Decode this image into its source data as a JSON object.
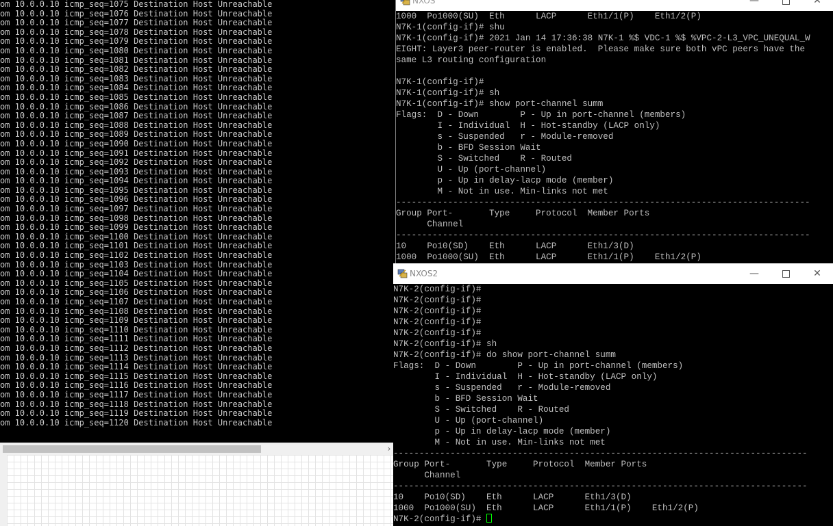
{
  "left_console": {
    "lines": [
      "om 10.0.0.10 icmp_seq=1075 Destination Host Unreachable",
      "om 10.0.0.10 icmp_seq=1076 Destination Host Unreachable",
      "om 10.0.0.10 icmp_seq=1077 Destination Host Unreachable",
      "om 10.0.0.10 icmp_seq=1078 Destination Host Unreachable",
      "om 10.0.0.10 icmp_seq=1079 Destination Host Unreachable",
      "om 10.0.0.10 icmp_seq=1080 Destination Host Unreachable",
      "om 10.0.0.10 icmp_seq=1081 Destination Host Unreachable",
      "om 10.0.0.10 icmp_seq=1082 Destination Host Unreachable",
      "om 10.0.0.10 icmp_seq=1083 Destination Host Unreachable",
      "om 10.0.0.10 icmp_seq=1084 Destination Host Unreachable",
      "om 10.0.0.10 icmp_seq=1085 Destination Host Unreachable",
      "om 10.0.0.10 icmp_seq=1086 Destination Host Unreachable",
      "om 10.0.0.10 icmp_seq=1087 Destination Host Unreachable",
      "om 10.0.0.10 icmp_seq=1088 Destination Host Unreachable",
      "om 10.0.0.10 icmp_seq=1089 Destination Host Unreachable",
      "om 10.0.0.10 icmp_seq=1090 Destination Host Unreachable",
      "om 10.0.0.10 icmp_seq=1091 Destination Host Unreachable",
      "om 10.0.0.10 icmp_seq=1092 Destination Host Unreachable",
      "om 10.0.0.10 icmp_seq=1093 Destination Host Unreachable",
      "om 10.0.0.10 icmp_seq=1094 Destination Host Unreachable",
      "om 10.0.0.10 icmp_seq=1095 Destination Host Unreachable",
      "om 10.0.0.10 icmp_seq=1096 Destination Host Unreachable",
      "om 10.0.0.10 icmp_seq=1097 Destination Host Unreachable",
      "om 10.0.0.10 icmp_seq=1098 Destination Host Unreachable",
      "om 10.0.0.10 icmp_seq=1099 Destination Host Unreachable",
      "om 10.0.0.10 icmp_seq=1100 Destination Host Unreachable",
      "om 10.0.0.10 icmp_seq=1101 Destination Host Unreachable",
      "om 10.0.0.10 icmp_seq=1102 Destination Host Unreachable",
      "om 10.0.0.10 icmp_seq=1103 Destination Host Unreachable",
      "om 10.0.0.10 icmp_seq=1104 Destination Host Unreachable",
      "om 10.0.0.10 icmp_seq=1105 Destination Host Unreachable",
      "om 10.0.0.10 icmp_seq=1106 Destination Host Unreachable",
      "om 10.0.0.10 icmp_seq=1107 Destination Host Unreachable",
      "om 10.0.0.10 icmp_seq=1108 Destination Host Unreachable",
      "om 10.0.0.10 icmp_seq=1109 Destination Host Unreachable",
      "om 10.0.0.10 icmp_seq=1110 Destination Host Unreachable",
      "om 10.0.0.10 icmp_seq=1111 Destination Host Unreachable",
      "om 10.0.0.10 icmp_seq=1112 Destination Host Unreachable",
      "om 10.0.0.10 icmp_seq=1113 Destination Host Unreachable",
      "om 10.0.0.10 icmp_seq=1114 Destination Host Unreachable",
      "om 10.0.0.10 icmp_seq=1115 Destination Host Unreachable",
      "om 10.0.0.10 icmp_seq=1116 Destination Host Unreachable",
      "om 10.0.0.10 icmp_seq=1117 Destination Host Unreachable",
      "om 10.0.0.10 icmp_seq=1118 Destination Host Unreachable",
      "om 10.0.0.10 icmp_seq=1119 Destination Host Unreachable",
      "om 10.0.0.10 icmp_seq=1120 Destination Host Unreachable"
    ],
    "scroll_right_icon": "chevron-right-icon"
  },
  "nxos1": {
    "title": "NXOS",
    "icon": "putty-icon",
    "lines": [
      "1000  Po1000(SU)  Eth      LACP      Eth1/1(P)    Eth1/2(P)",
      "N7K-1(config-if)# shu",
      "N7K-1(config-if)# 2021 Jan 14 17:36:38 N7K-1 %$ VDC-1 %$ %VPC-2-L3_VPC_UNEQUAL_W",
      "EIGHT: Layer3 peer-router is enabled.  Please make sure both vPC peers have the",
      "same L3 routing configuration",
      "",
      "N7K-1(config-if)#",
      "N7K-1(config-if)# sh",
      "N7K-1(config-if)# show port-channel summ",
      "Flags:  D - Down        P - Up in port-channel (members)",
      "        I - Individual  H - Hot-standby (LACP only)",
      "        s - Suspended   r - Module-removed",
      "        b - BFD Session Wait",
      "        S - Switched    R - Routed",
      "        U - Up (port-channel)",
      "        p - Up in delay-lacp mode (member)",
      "        M - Not in use. Min-links not met",
      "--------------------------------------------------------------------------------",
      "Group Port-       Type     Protocol  Member Ports",
      "      Channel",
      "--------------------------------------------------------------------------------",
      "10    Po10(SD)    Eth      LACP      Eth1/3(D)",
      "1000  Po1000(SU)  Eth      LACP      Eth1/1(P)    Eth1/2(P)"
    ]
  },
  "nxos2": {
    "title": "NXOS2",
    "icon": "putty-icon",
    "lines": [
      "N7K-2(config-if)#",
      "N7K-2(config-if)#",
      "N7K-2(config-if)#",
      "N7K-2(config-if)#",
      "N7K-2(config-if)#",
      "N7K-2(config-if)# sh",
      "N7K-2(config-if)# do show port-channel summ",
      "Flags:  D - Down        P - Up in port-channel (members)",
      "        I - Individual  H - Hot-standby (LACP only)",
      "        s - Suspended   r - Module-removed",
      "        b - BFD Session Wait",
      "        S - Switched    R - Routed",
      "        U - Up (port-channel)",
      "        p - Up in delay-lacp mode (member)",
      "        M - Not in use. Min-links not met",
      "--------------------------------------------------------------------------------",
      "Group Port-       Type     Protocol  Member Ports",
      "      Channel",
      "--------------------------------------------------------------------------------",
      "10    Po10(SD)    Eth      LACP      Eth1/3(D)",
      "1000  Po1000(SU)  Eth      LACP      Eth1/1(P)    Eth1/2(P)"
    ],
    "prompt": "N7K-2(config-if)# "
  },
  "window_controls": {
    "minimize": "—",
    "close": "✕"
  },
  "colors": {
    "terminal_bg": "#000000",
    "terminal_fg": "#c0c0c0",
    "cursor": "#00ff00"
  }
}
